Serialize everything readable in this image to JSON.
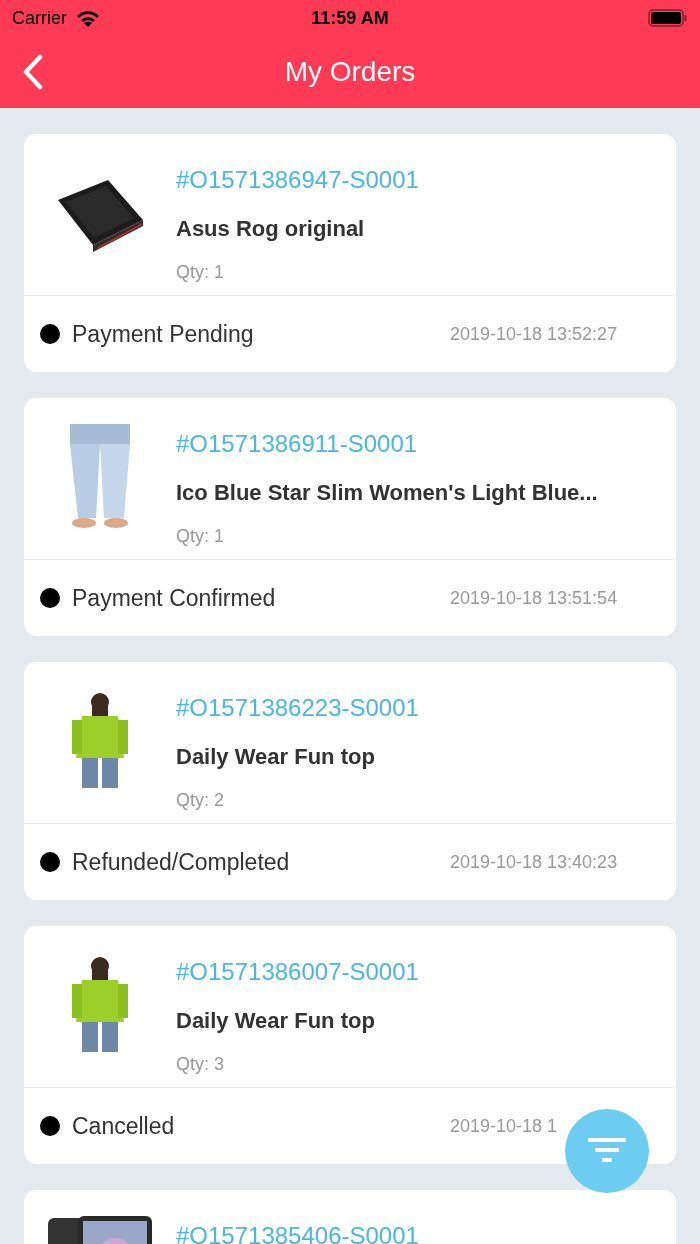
{
  "status_bar": {
    "carrier": "Carrier",
    "time": "11:59 AM"
  },
  "header": {
    "title": "My Orders"
  },
  "orders": [
    {
      "order_no": "#O1571386947-S0001",
      "name": "Asus Rog original",
      "qty": "Qty: 1",
      "status": "Payment Pending",
      "time": "2019-10-18 13:52:27"
    },
    {
      "order_no": "#O1571386911-S0001",
      "name": "Ico Blue Star Slim Women's Light Blue...",
      "qty": "Qty: 1",
      "status": "Payment Confirmed",
      "time": "2019-10-18 13:51:54"
    },
    {
      "order_no": "#O1571386223-S0001",
      "name": "Daily Wear Fun top",
      "qty": "Qty: 2",
      "status": "Refunded/Completed",
      "time": "2019-10-18 13:40:23"
    },
    {
      "order_no": "#O1571386007-S0001",
      "name": "Daily Wear Fun top",
      "qty": "Qty: 3",
      "status": "Cancelled",
      "time": "2019-10-18 1"
    },
    {
      "order_no": "#O1571385406-S0001"
    }
  ]
}
